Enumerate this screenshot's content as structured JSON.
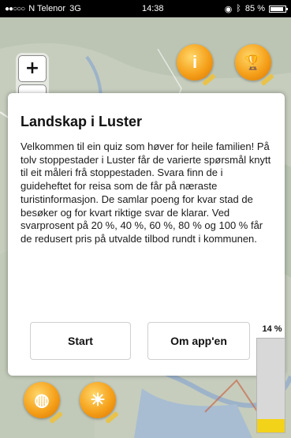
{
  "status_bar": {
    "carrier": "N Telenor",
    "network": "3G",
    "time": "14:38",
    "battery": "85 %"
  },
  "zoom": {
    "in_label": "+",
    "out_label": "−"
  },
  "map_icons": [
    {
      "name": "info",
      "glyph": "i"
    },
    {
      "name": "trophy",
      "glyph": "🏆"
    },
    {
      "name": "globe",
      "glyph": "◍"
    },
    {
      "name": "sun",
      "glyph": "☀"
    }
  ],
  "dialog": {
    "title": "Landskap i Luster",
    "body": "Velkommen til ein quiz som høver for heile familien! På tolv stoppestader i Luster får de varierte spørsmål knytt til eit måleri frå stoppestaden. Svara finn de i guideheftet for reisa som de får på næraste turistinformasjon. De samlar poeng for kvar stad de besøker og for kvart riktige svar de klarar. Ved svarprosent på 20 %, 40 %, 60 %, 80 % og 100 % får de redusert pris på utvalde tilbod rundt i kommunen.",
    "start_label": "Start",
    "about_label": "Om app'en"
  },
  "progress": {
    "label": "14 %",
    "value": 0.14
  },
  "colors": {
    "accent": "#f5a01a",
    "progress_fill": "#f3d21a",
    "map_bg": "#c9d0c3"
  }
}
